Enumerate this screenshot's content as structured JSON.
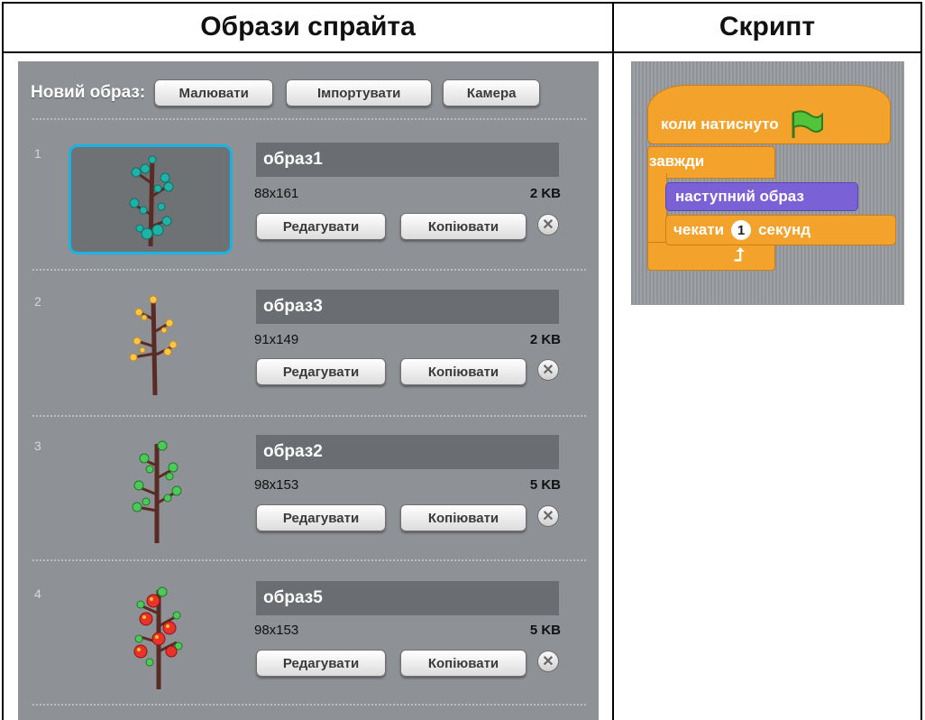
{
  "table": {
    "col1_header": "Образи спрайта",
    "col2_header": "Скрипт"
  },
  "costumes_panel": {
    "new_costume_label": "Новий образ:",
    "paint_label": "Малювати",
    "import_label": "Імпортувати",
    "camera_label": "Камера",
    "edit_label": "Редагувати",
    "copy_label": "Копіювати",
    "delete_icon": "close-icon",
    "selected_highlight": "#1ab3e4",
    "costumes": [
      {
        "index": "1",
        "name": "образ1",
        "dims": "88x161",
        "size": "2 KB",
        "leaf_color": "teal",
        "selected": true
      },
      {
        "index": "2",
        "name": "образ3",
        "dims": "91x149",
        "size": "2 KB",
        "leaf_color": "yellow",
        "selected": false
      },
      {
        "index": "3",
        "name": "образ2",
        "dims": "98x153",
        "size": "5 KB",
        "leaf_color": "green",
        "selected": false
      },
      {
        "index": "4",
        "name": "образ5",
        "dims": "98x153",
        "size": "5 KB",
        "leaf_color": "red-apples",
        "selected": false
      }
    ]
  },
  "script": {
    "hat_text": "коли натиснуто",
    "hat_icon": "green-flag-icon",
    "forever_text": "завжди",
    "next_costume_text": "наступний образ",
    "wait_text": "чекати",
    "wait_value": "1",
    "wait_unit": "секунд",
    "loop_icon": "loop-arrow-icon",
    "control_color": "#f3a32b",
    "looks_color": "#7a62d6"
  }
}
